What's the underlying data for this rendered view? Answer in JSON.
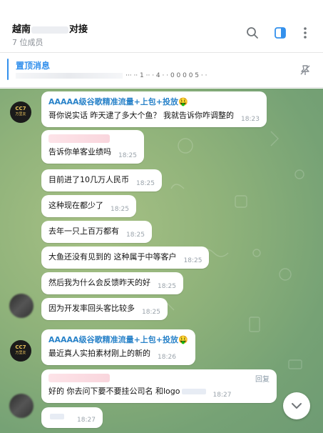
{
  "header": {
    "title_left": "越南",
    "title_right": "对接",
    "members": "7 位成员",
    "icons": [
      "search-icon",
      "sidebar-panel-icon",
      "more-vert-icon"
    ]
  },
  "pinned": {
    "label": "置顶消息",
    "preview": "··· ·· 1 ·· · 4 · · 0 0 0 0 5 · ·"
  },
  "colors": {
    "accent": "#3390ec",
    "sender": "#2a83c9",
    "chat_bg": "#8fb27a"
  },
  "messages": [
    {
      "sender": "AAAAA级谷歌精准流量+上包+投放",
      "emoji": "🤑",
      "text": "哥你说实话 昨天逮了多大个鱼？ 我就告诉你咋调整的",
      "time": "18:23"
    },
    {
      "text": "告诉你单客业绩吗",
      "time": "18:25"
    },
    {
      "text": "目前进了10几万人民币",
      "time": "18:25"
    },
    {
      "text": "这种现在都少了",
      "time": "18:25"
    },
    {
      "text": "去年一只上百万都有",
      "time": "18:25"
    },
    {
      "text": "大鱼还没有见到的 这种属于中等客户",
      "time": "18:25"
    },
    {
      "text": "然后我为什么会反馈昨天的好",
      "time": "18:25"
    },
    {
      "text": "因为开发率回头客比较多",
      "time": "18:25"
    },
    {
      "sender": "AAAAA级谷歌精准流量+上包+投放",
      "emoji": "🤑",
      "text": "最近真人实拍素材刚上的新的",
      "time": "18:26"
    },
    {
      "reply": "回复",
      "text": "好的 你去问下要不要挂公司名 和logo",
      "time": "18:27"
    },
    {
      "text": "",
      "time": "18:27"
    }
  ],
  "avatar": {
    "line1": "CC7",
    "line2": "万里友"
  }
}
